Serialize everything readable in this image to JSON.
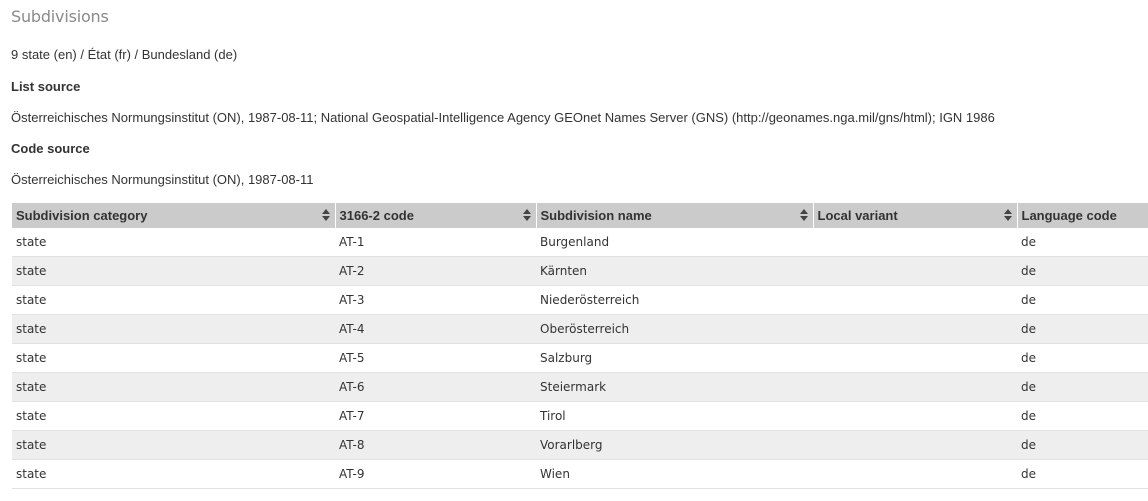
{
  "section_title": "Subdivisions",
  "summary": "9 state (en) / État (fr) / Bundesland (de)",
  "list_source_label": "List source",
  "list_source_text": "Österreichisches Normungsinstitut (ON), 1987-08-11; National Geospatial-Intelligence Agency GEOnet Names Server (GNS) (http://geonames.nga.mil/gns/html); IGN 1986",
  "code_source_label": "Code source",
  "code_source_text": "Österreichisches Normungsinstitut (ON), 1987-08-11",
  "table": {
    "headers": [
      "Subdivision category",
      "3166-2 code",
      "Subdivision name",
      "Local variant",
      "Language code"
    ],
    "rows": [
      [
        "state",
        "AT-1",
        "Burgenland",
        "",
        "de"
      ],
      [
        "state",
        "AT-2",
        "Kärnten",
        "",
        "de"
      ],
      [
        "state",
        "AT-3",
        "Niederösterreich",
        "",
        "de"
      ],
      [
        "state",
        "AT-4",
        "Oberösterreich",
        "",
        "de"
      ],
      [
        "state",
        "AT-5",
        "Salzburg",
        "",
        "de"
      ],
      [
        "state",
        "AT-6",
        "Steiermark",
        "",
        "de"
      ],
      [
        "state",
        "AT-7",
        "Tirol",
        "",
        "de"
      ],
      [
        "state",
        "AT-8",
        "Vorarlberg",
        "",
        "de"
      ],
      [
        "state",
        "AT-9",
        "Wien",
        "",
        "de"
      ]
    ]
  },
  "icons": {
    "sort": "sort-icon"
  }
}
